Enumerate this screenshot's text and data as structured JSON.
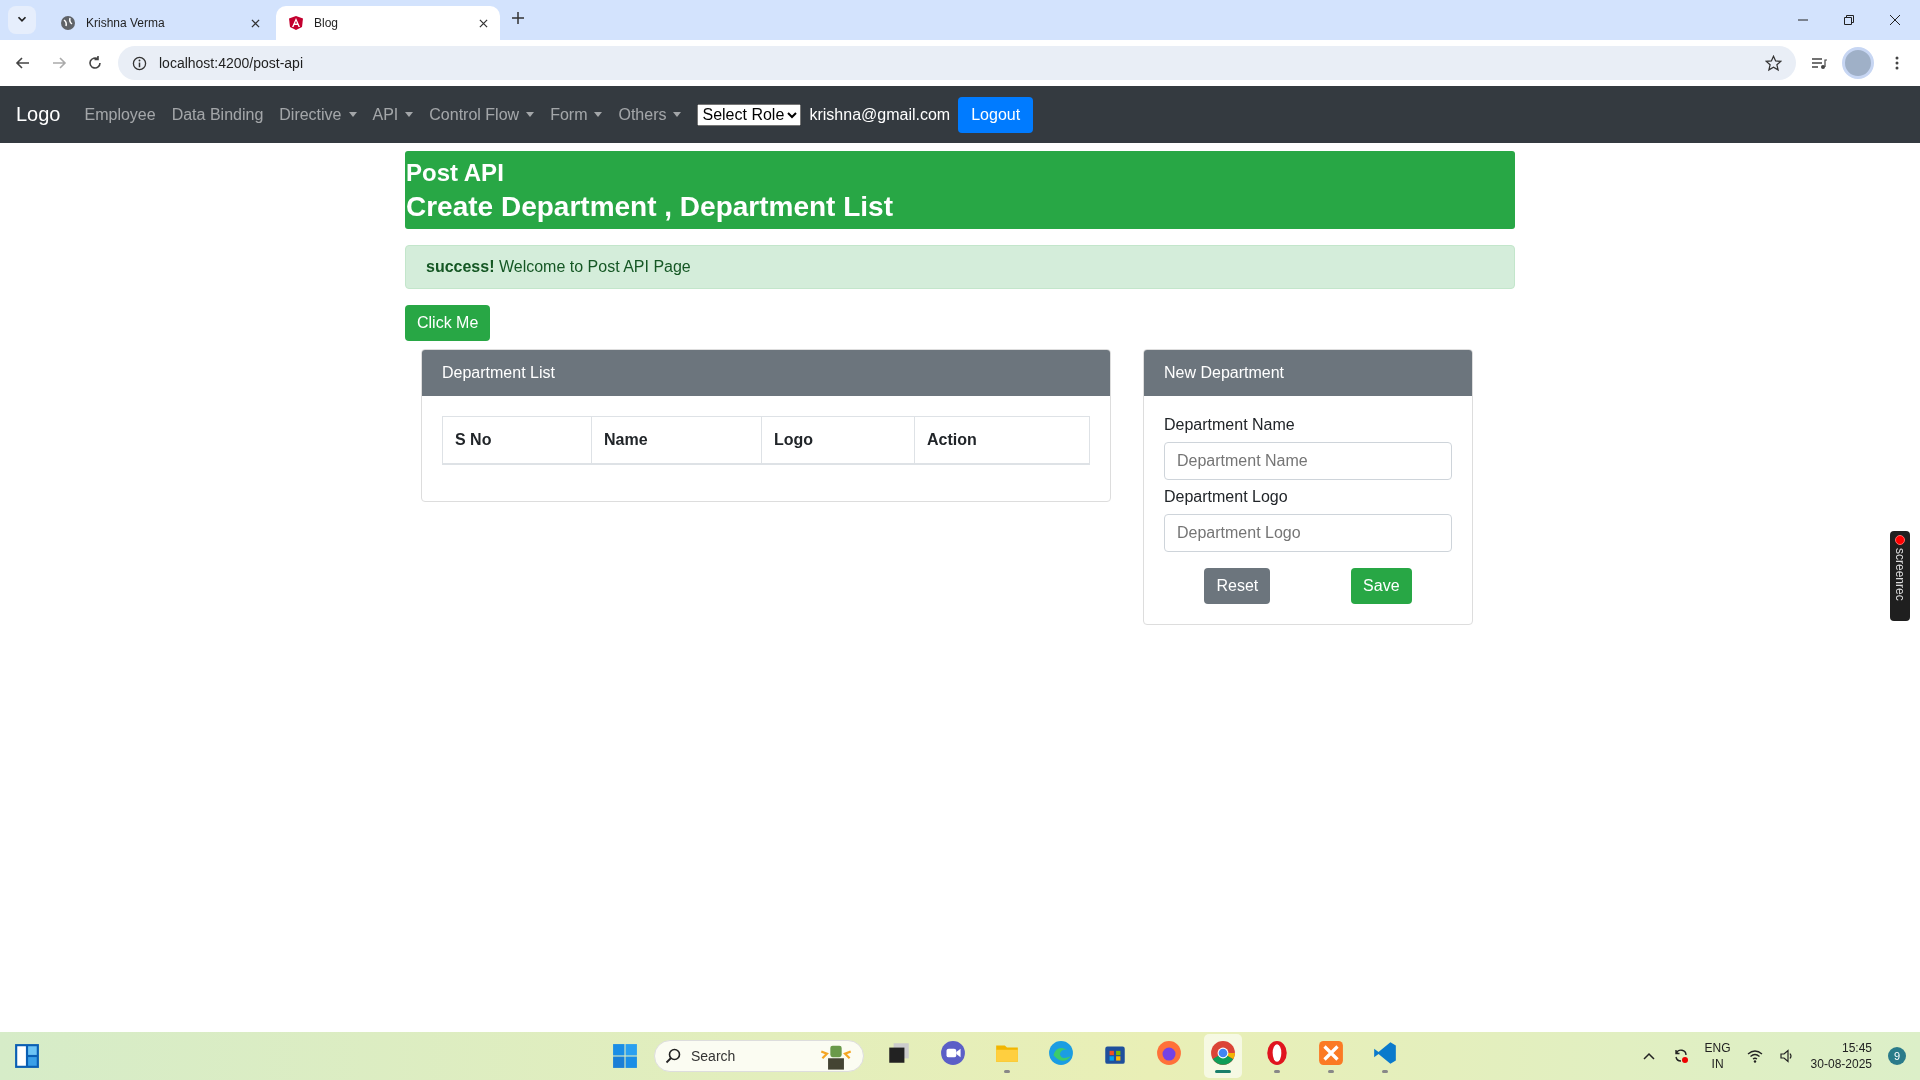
{
  "browser": {
    "tabs": [
      {
        "title": "Krishna Verma",
        "selected": false,
        "kind": "globe"
      },
      {
        "title": "Blog",
        "selected": true,
        "kind": "angular"
      }
    ],
    "url": "localhost:4200/post-api"
  },
  "navbar": {
    "brand": "Logo",
    "items": [
      {
        "label": "Employee",
        "kind": "link"
      },
      {
        "label": "Data Binding",
        "kind": "link"
      },
      {
        "label": "Directive",
        "kind": "dropdown"
      },
      {
        "label": "API",
        "kind": "dropdown"
      },
      {
        "label": "Control Flow",
        "kind": "dropdown"
      },
      {
        "label": "Form",
        "kind": "dropdown"
      },
      {
        "label": "Others",
        "kind": "dropdown"
      }
    ],
    "role_select": "Select Role",
    "email": "krishna@gmail.com",
    "logout": "Logout"
  },
  "header": {
    "title": "Post API",
    "subtitle": "Create Department , Department List"
  },
  "alert": {
    "strong": "success!",
    "message": "Welcome to Post API Page"
  },
  "click_button": "Click Me",
  "list_card": {
    "title": "Department List",
    "columns": [
      "S No",
      "Name",
      "Logo",
      "Action"
    ]
  },
  "form_card": {
    "title": "New Department",
    "fields": [
      {
        "label": "Department Name",
        "placeholder": "Department Name"
      },
      {
        "label": "Department Logo",
        "placeholder": "Department Logo"
      }
    ],
    "reset": "Reset",
    "save": "Save"
  },
  "recorder": "screenrec",
  "taskbar": {
    "search": "Search",
    "apps": [
      {
        "kind": "files",
        "running": false,
        "active": false
      },
      {
        "kind": "meet",
        "running": false,
        "active": false
      },
      {
        "kind": "folder",
        "running": true,
        "active": false
      },
      {
        "kind": "edge",
        "running": false,
        "active": false
      },
      {
        "kind": "store",
        "running": false,
        "active": false
      },
      {
        "kind": "firefox",
        "running": false,
        "active": false
      },
      {
        "kind": "chrome",
        "running": true,
        "active": true
      },
      {
        "kind": "opera",
        "running": true,
        "active": false
      },
      {
        "kind": "xampp",
        "running": true,
        "active": false
      },
      {
        "kind": "vscode",
        "running": true,
        "active": false
      }
    ],
    "lang": "ENG",
    "region": "IN",
    "time": "15:45",
    "date": "30-08-2025",
    "badge": "9"
  }
}
